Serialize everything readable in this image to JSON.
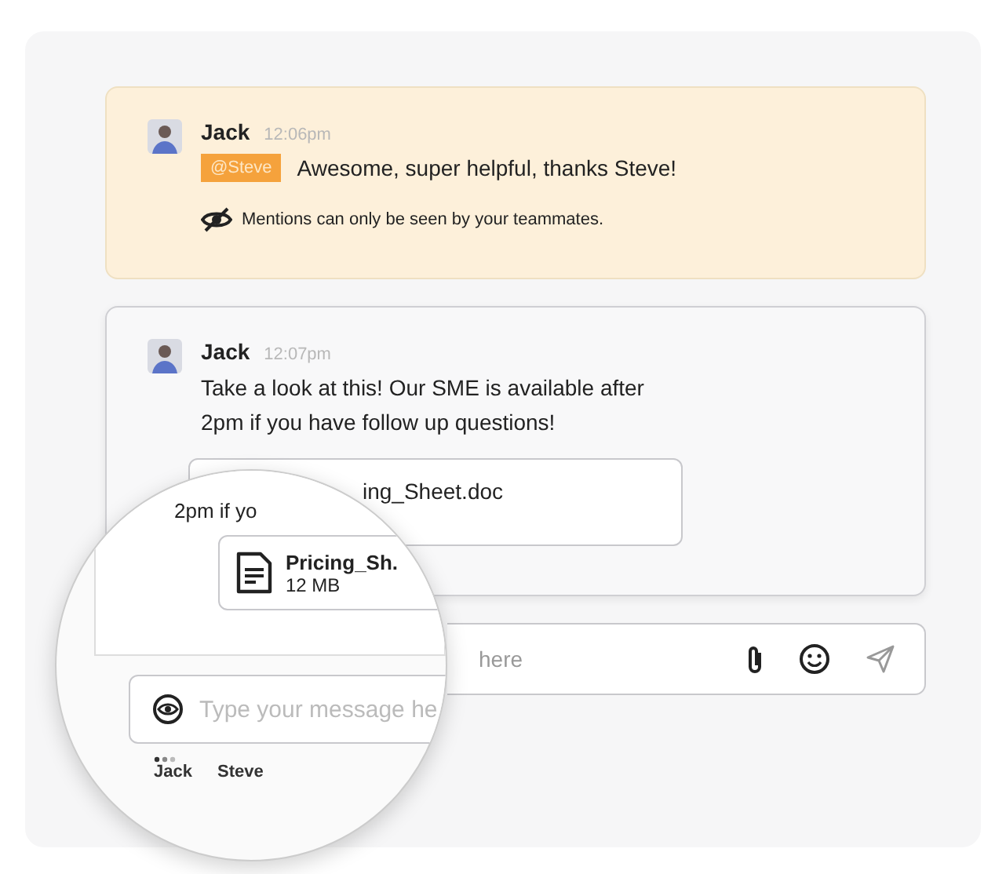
{
  "messages": [
    {
      "kind": "mention",
      "author": "Jack",
      "time": "12:06pm",
      "mention": "@Steve",
      "text": "Awesome, super helpful, thanks Steve!",
      "notice": "Mentions can only be seen by your teammates."
    },
    {
      "kind": "attachment",
      "author": "Jack",
      "time": "12:07pm",
      "text": "Take a look at this! Our SME is available after 2pm if you have follow up questions!",
      "file_name": "ing_Sheet.doc"
    }
  ],
  "composer": {
    "placeholder": "here"
  },
  "magnifier": {
    "text": "2pm if yo",
    "file": {
      "name": "Pricing_Sh.",
      "size": "12 MB"
    },
    "composer": {
      "placeholder": "Type your message he"
    },
    "participants": [
      "Jack",
      "Steve"
    ]
  }
}
